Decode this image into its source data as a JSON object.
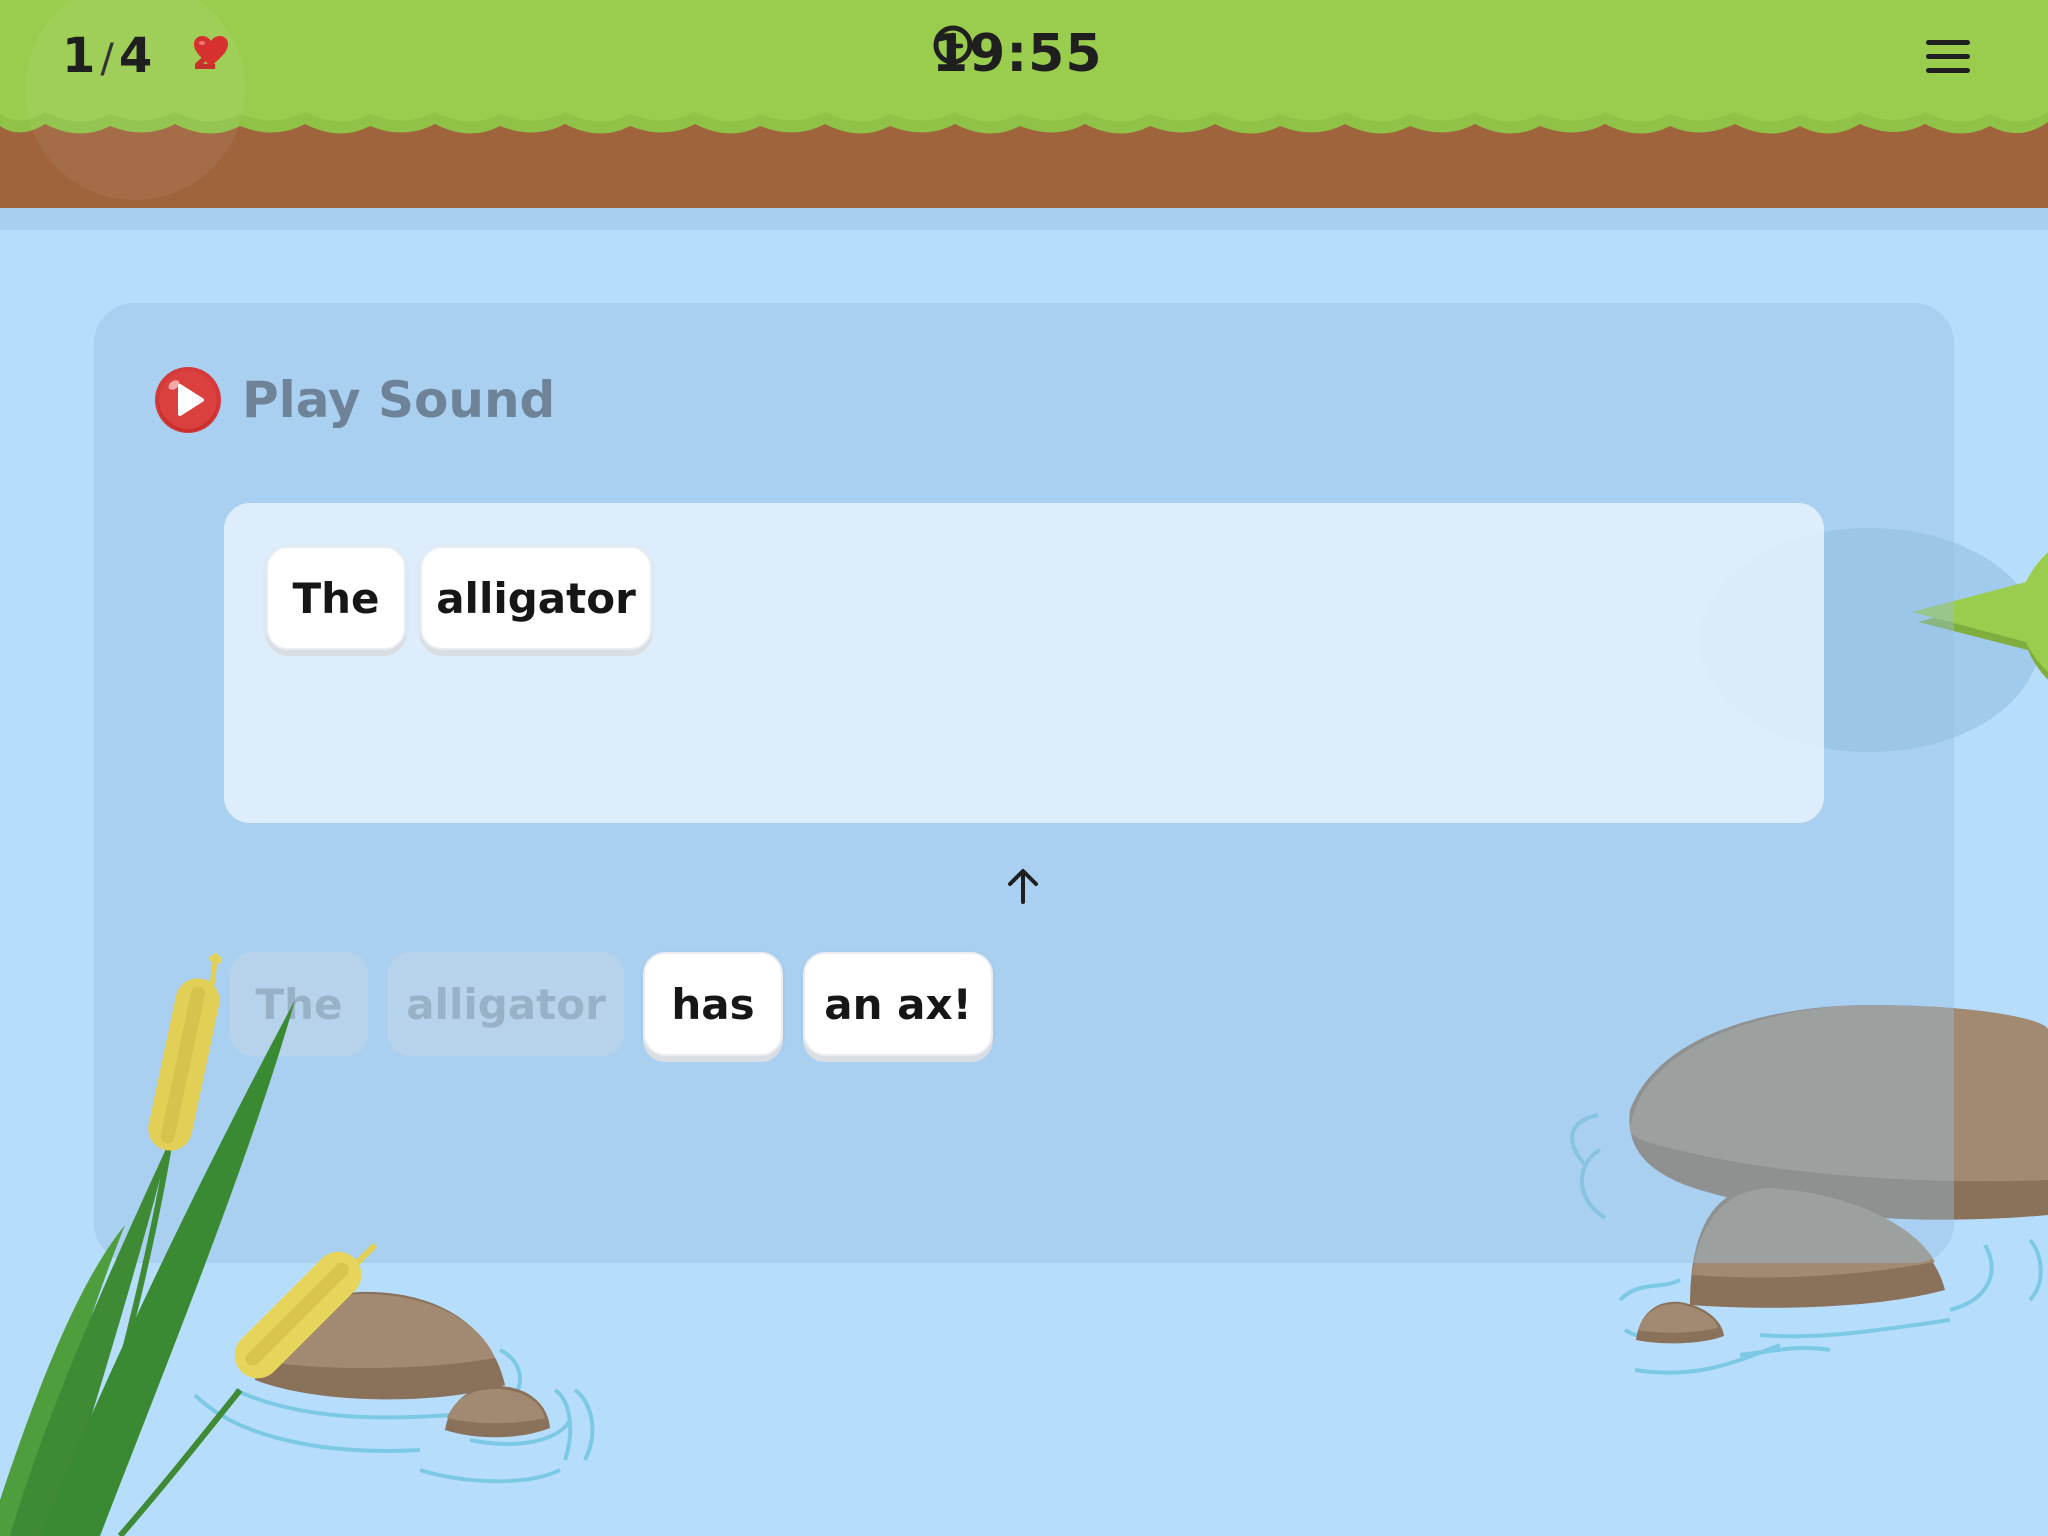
{
  "header": {
    "progress_current": "1",
    "progress_separator": "/",
    "progress_total": "4",
    "lives": "2",
    "timer": "19:55"
  },
  "icons": {
    "lives": "heart-icon",
    "timer": "clock-icon",
    "menu": "hamburger-menu-icon",
    "play": "play-icon",
    "arrow": "arrow-up-icon"
  },
  "play_sound": {
    "label": "Play Sound"
  },
  "answer_tiles": [
    {
      "word": "The"
    },
    {
      "word": "alligator"
    }
  ],
  "word_bank": [
    {
      "word": "The",
      "used": true
    },
    {
      "word": "alligator",
      "used": true
    },
    {
      "word": "has",
      "used": false
    },
    {
      "word": "an ax!",
      "used": false
    }
  ],
  "colors": {
    "grass": "#9acc4e",
    "dirt": "#a0643c",
    "water": "#b7ddfc",
    "heart": "#d7312f",
    "play_button": "#d43a3a"
  }
}
